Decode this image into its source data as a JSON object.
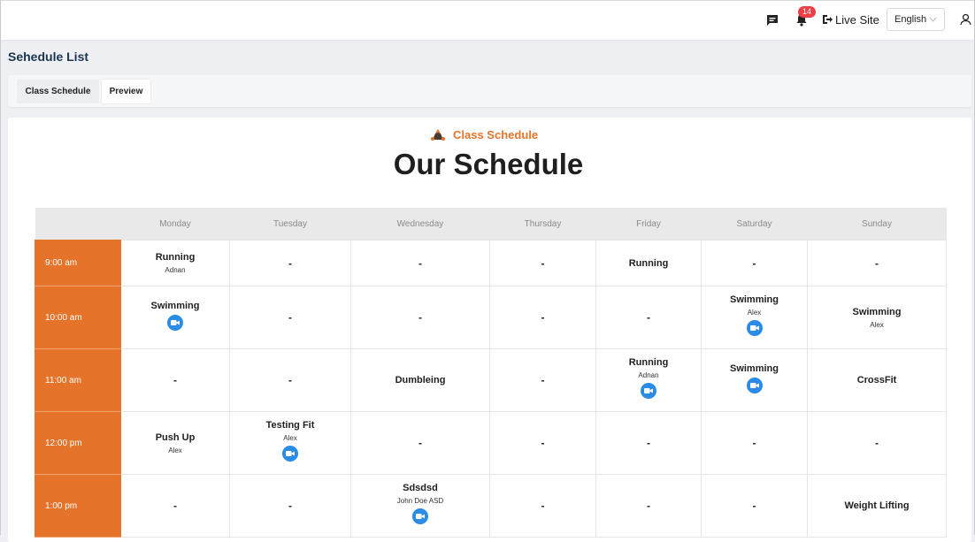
{
  "header": {
    "notification_count": "14",
    "live_site_label": "Live Site",
    "language": "English"
  },
  "page": {
    "title": "Sehedule List",
    "tabs": [
      {
        "label": "Class Schedule"
      },
      {
        "label": "Preview"
      }
    ]
  },
  "preview": {
    "subtitle": "Class Schedule",
    "title": "Our Schedule"
  },
  "schedule": {
    "days": [
      "Monday",
      "Tuesday",
      "Wednesday",
      "Thursday",
      "Friday",
      "Saturday",
      "Sunday"
    ],
    "rows": [
      {
        "time": "9:00 am",
        "cells": [
          {
            "name": "Running",
            "trainer": "Adnan",
            "video": false
          },
          {
            "name": "-",
            "trainer": "",
            "video": false
          },
          {
            "name": "-",
            "trainer": "",
            "video": false
          },
          {
            "name": "-",
            "trainer": "",
            "video": false
          },
          {
            "name": "Running",
            "trainer": "",
            "video": false
          },
          {
            "name": "-",
            "trainer": "",
            "video": false
          },
          {
            "name": "-",
            "trainer": "",
            "video": false
          }
        ]
      },
      {
        "time": "10:00 am",
        "cells": [
          {
            "name": "Swimming",
            "trainer": "",
            "video": true
          },
          {
            "name": "-",
            "trainer": "",
            "video": false
          },
          {
            "name": "-",
            "trainer": "",
            "video": false
          },
          {
            "name": "-",
            "trainer": "",
            "video": false
          },
          {
            "name": "-",
            "trainer": "",
            "video": false
          },
          {
            "name": "Swimming",
            "trainer": "Alex",
            "video": true
          },
          {
            "name": "Swimming",
            "trainer": "Alex",
            "video": false
          }
        ]
      },
      {
        "time": "11:00 am",
        "cells": [
          {
            "name": "-",
            "trainer": "",
            "video": false
          },
          {
            "name": "-",
            "trainer": "",
            "video": false
          },
          {
            "name": "Dumbleing",
            "trainer": "",
            "video": false
          },
          {
            "name": "-",
            "trainer": "",
            "video": false
          },
          {
            "name": "Running",
            "trainer": "Adnan",
            "video": true
          },
          {
            "name": "Swimming",
            "trainer": "",
            "video": true
          },
          {
            "name": "CrossFit",
            "trainer": "",
            "video": false
          }
        ]
      },
      {
        "time": "12:00 pm",
        "cells": [
          {
            "name": "Push Up",
            "trainer": "Alex",
            "video": false
          },
          {
            "name": "Testing Fit",
            "trainer": "Alex",
            "video": true
          },
          {
            "name": "-",
            "trainer": "",
            "video": false
          },
          {
            "name": "-",
            "trainer": "",
            "video": false
          },
          {
            "name": "-",
            "trainer": "",
            "video": false
          },
          {
            "name": "-",
            "trainer": "",
            "video": false
          },
          {
            "name": "-",
            "trainer": "",
            "video": false
          }
        ]
      },
      {
        "time": "1:00 pm",
        "cells": [
          {
            "name": "-",
            "trainer": "",
            "video": false
          },
          {
            "name": "-",
            "trainer": "",
            "video": false
          },
          {
            "name": "Sdsdsd",
            "trainer": "John Doe ASD",
            "video": true
          },
          {
            "name": "-",
            "trainer": "",
            "video": false
          },
          {
            "name": "-",
            "trainer": "",
            "video": false
          },
          {
            "name": "-",
            "trainer": "",
            "video": false
          },
          {
            "name": "Weight Lifting",
            "trainer": "",
            "video": false
          }
        ]
      }
    ]
  },
  "colors": {
    "accent": "#e5732a",
    "video_button": "#2b8ce6",
    "title_text": "#1a3550"
  },
  "icons": [
    "chat-icon",
    "bell-icon",
    "logout-icon",
    "user-icon",
    "chevron-down-icon",
    "fitness-logo-icon",
    "video-camera-icon"
  ]
}
